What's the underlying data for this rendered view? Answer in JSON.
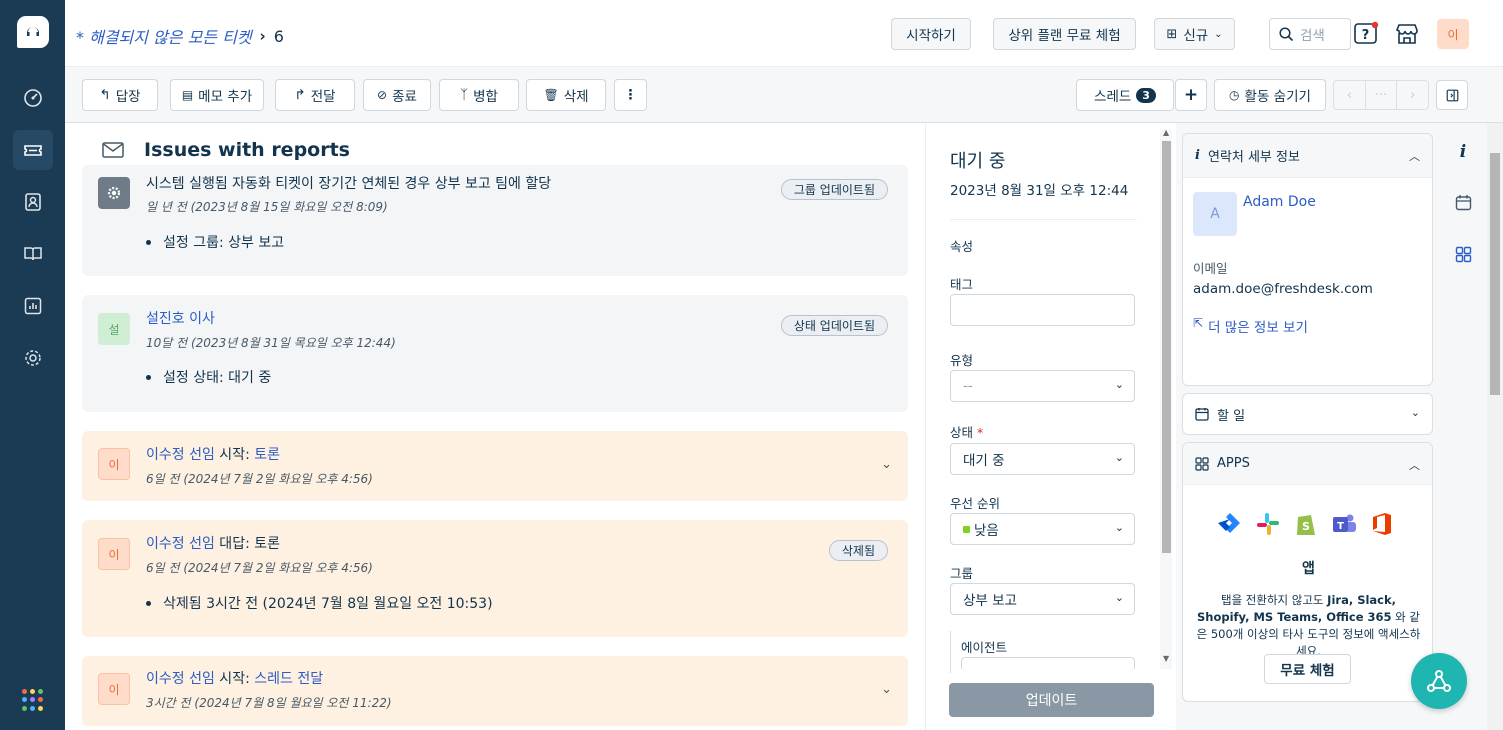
{
  "brand": {
    "accent": "#2c5cc5",
    "sidebar_bg": "#1b3a53"
  },
  "header": {
    "view_name": "* 해결되지 않은 모든 티켓",
    "ticket_count": "6",
    "start_btn": "시작하기",
    "upgrade_btn": "상위 플랜 무료 체험",
    "new_btn": "신규",
    "search_placeholder": "검색",
    "avatar_initial": "이"
  },
  "actions": {
    "reply": "답장",
    "add_note": "메모 추가",
    "forward": "전달",
    "close": "종료",
    "merge": "병합",
    "delete": "삭제",
    "thread_label": "스레드",
    "thread_count": "3",
    "hide_activity": "활동 숨기기",
    "pager_more": "···"
  },
  "ticket": {
    "subject": "Issues with reports",
    "activities": [
      {
        "title": "시스템 실행됨 자동화 티켓이 장기간 연체된 경우 상부 보고 팀에 할당",
        "time": "일 년 전 (2023년 8월 15일 화요일 오전 8:09)",
        "badge": "그룹 업데이트됨",
        "detail": "설정 그룹: 상부 보고"
      },
      {
        "actor": "설진호 이사",
        "time": "10달 전 (2023년 8월 31일 목요일 오후 12:44)",
        "badge": "상태 업데이트됨",
        "detail": "설정 상태: 대기 중",
        "avatar": "설"
      },
      {
        "actor": "이수정 선임",
        "verb": " 시작: ",
        "target": "토론",
        "time": "6일 전 (2024년 7월 2일 화요일 오후 4:56)",
        "avatar": "이"
      },
      {
        "actor": "이수정 선임",
        "verb": " 대답: ",
        "target": "토론",
        "time": "6일 전 (2024년 7월 2일 화요일 오후 4:56)",
        "badge": "삭제됨",
        "detail": "삭제됨 3시간 전 (2024년 7월 8일 월요일 오전 10:53)",
        "avatar": "이"
      },
      {
        "actor": "이수정 선임",
        "verb": " 시작: ",
        "target": "스레드 전달",
        "time": "3시간 전 (2024년 7월 8일 월요일 오전 11:22)",
        "avatar": "이"
      }
    ]
  },
  "properties": {
    "status_title": "대기 중",
    "status_date": "2023년 8월 31일 오후 12:44",
    "section": "속성",
    "tags_label": "태그",
    "tags_value": "",
    "type_label": "유형",
    "type_value": "--",
    "status_label": "상태",
    "status_required": "*",
    "status_value": "대기 중",
    "priority_label": "우선 순위",
    "priority_value": "낮음",
    "group_label": "그룹",
    "group_value": "상부 보고",
    "agent_label": "에이전트",
    "update_btn": "업데이트"
  },
  "contact": {
    "panel_title": "연락처 세부 정보",
    "avatar": "A",
    "name": "Adam Doe",
    "email_label": "이메일",
    "email": "adam.doe@freshdesk.com",
    "more_info": "더 많은 정보 보기"
  },
  "todo": {
    "title": "할 일"
  },
  "apps": {
    "title": "APPS",
    "heading": "앱",
    "desc_prefix": "탭을 전환하지 않고도 ",
    "desc_bold": "Jira, Slack, Shopify, MS Teams, Office 365",
    "desc_suffix": " 와 같은 500개 이상의 타사 도구의 정보에 액세스하세요.",
    "trial_btn": "무료 체험"
  }
}
